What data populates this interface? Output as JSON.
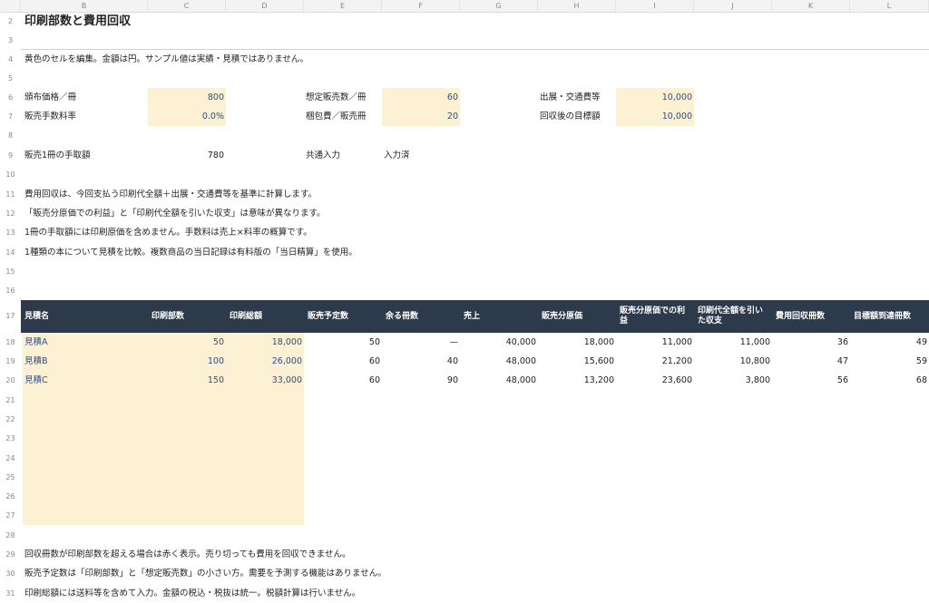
{
  "columns": [
    "B",
    "C",
    "D",
    "E",
    "F",
    "G",
    "H",
    "I",
    "J",
    "K",
    "L"
  ],
  "rows": [
    "2",
    "3",
    "4",
    "5",
    "6",
    "7",
    "8",
    "9",
    "10",
    "11",
    "12",
    "13",
    "14",
    "15",
    "16",
    "17",
    "18",
    "19",
    "20",
    "21",
    "22",
    "23",
    "24",
    "25",
    "26",
    "27",
    "28",
    "29",
    "30",
    "31"
  ],
  "title": "印刷部数と費用回収",
  "note_top": "黄色のセルを編集。金額は円。サンプル値は実績・見積ではありません。",
  "inputs": {
    "price_label": "頒布価格／冊",
    "price": "800",
    "fee_label": "販売手数料率",
    "fee": "0.0%",
    "expected_label": "想定販売数／冊",
    "expected": "60",
    "packing_label": "梱包費／販売冊",
    "packing": "20",
    "travel_label": "出展・交通費等",
    "travel": "10,000",
    "target_label": "回収後の目標額",
    "target": "10,000"
  },
  "net_label": "販売1冊の手取額",
  "net_value": "780",
  "common_label": "共通入力",
  "common_status": "入力済",
  "notes_mid": [
    "費用回収は、今回支払う印刷代全額＋出展・交通費等を基準に計算します。",
    "「販売分原価での利益」と「印刷代全額を引いた収支」は意味が異なります。",
    "1冊の手取額には印刷原価を含めません。手数料は売上×料率の概算です。",
    "1種類の本について見積を比較。複数商品の当日記録は有料版の「当日精算」を使用。"
  ],
  "table": {
    "headers": [
      "見積名",
      "印刷部数",
      "印刷総額",
      "販売予定数",
      "余る冊数",
      "売上",
      "販売分原価",
      "販売分原価での利益",
      "印刷代全額を引いた収支",
      "費用回収冊数",
      "目標額到達冊数"
    ],
    "rows": [
      [
        "見積A",
        "50",
        "18,000",
        "50",
        "—",
        "40,000",
        "18,000",
        "11,000",
        "11,000",
        "36",
        "49"
      ],
      [
        "見積B",
        "100",
        "26,000",
        "60",
        "40",
        "48,000",
        "15,600",
        "21,200",
        "10,800",
        "47",
        "59"
      ],
      [
        "見積C",
        "150",
        "33,000",
        "60",
        "90",
        "48,000",
        "13,200",
        "23,600",
        "3,800",
        "56",
        "68"
      ]
    ]
  },
  "notes_bottom": [
    "回収冊数が印刷部数を超える場合は赤く表示。売り切っても費用を回収できません。",
    "販売予定数は「印刷部数」と「想定販売数」の小さい方。需要を予測する機能はありません。",
    "印刷総額には送料等を含めて入力。金額の税込・税抜は統一。税額計算は行いません。"
  ]
}
